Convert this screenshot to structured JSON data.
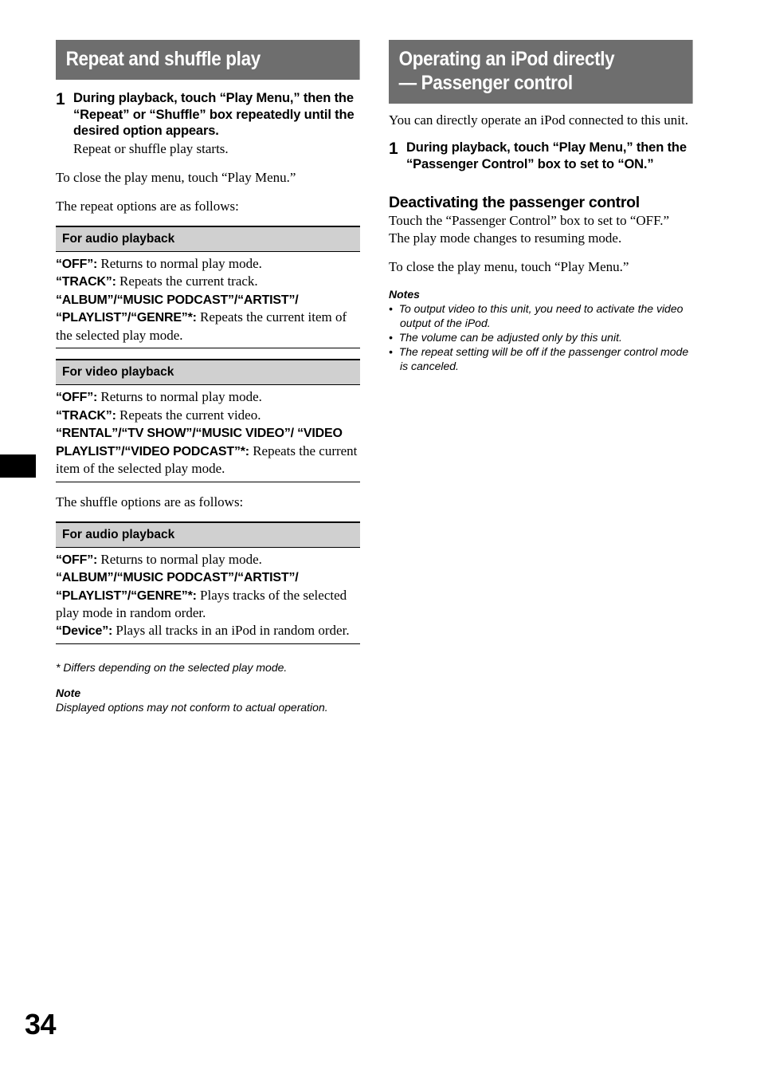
{
  "page": {
    "folio": "34",
    "edge_tab_color": "#000000",
    "header_bar_color": "#6e6e6e",
    "band_color": "#d0d0d0"
  },
  "left_column": {
    "header": {
      "lines": [
        "Repeat and shuffle play"
      ]
    },
    "step": {
      "number": "1",
      "title": "During playback, touch “Play Menu,” then the “Repeat” or “Shuffle” box repeatedly until the desired option appears.",
      "sub": "Repeat or shuffle play starts."
    },
    "close_note": "To close the play menu, touch “Play Menu.”",
    "repeat_intro": "The repeat options are as follows:",
    "repeat_audio": {
      "band": "For audio playback",
      "options": [
        {
          "term": "“OFF”:",
          "desc": " Returns to normal play mode."
        },
        {
          "term": "“TRACK”:",
          "desc": " Repeats the current track."
        },
        {
          "term": "“ALBUM”/“MUSIC PODCAST”/“ARTIST”/ “PLAYLIST”/“GENRE”*:",
          "desc": " Repeats the current item of the selected play mode."
        }
      ]
    },
    "repeat_video": {
      "band": "For video playback",
      "options": [
        {
          "term": "“OFF”:",
          "desc": " Returns to normal play mode."
        },
        {
          "term": "“TRACK”:",
          "desc": " Repeats the current video."
        },
        {
          "term": "“RENTAL”/“TV SHOW”/“MUSIC VIDEO”/ “VIDEO PLAYLIST”/“VIDEO PODCAST”*:",
          "desc": " Repeats the current item of the selected play mode."
        }
      ]
    },
    "shuffle_intro": "The shuffle options are as follows:",
    "shuffle_audio": {
      "band": "For audio playback",
      "options": [
        {
          "term": "“OFF”:",
          "desc": " Returns to normal play mode."
        },
        {
          "term": "“ALBUM”/“MUSIC PODCAST”/“ARTIST”/ “PLAYLIST”/“GENRE”*:",
          "desc": " Plays tracks of the selected play mode in random order."
        },
        {
          "term": "“Device”:",
          "desc": " Plays all tracks in an iPod in random order."
        }
      ]
    },
    "footnote": "* Differs depending on the selected play mode.",
    "note_head": "Note",
    "note_body": "Displayed options may not conform to actual operation."
  },
  "right_column": {
    "header": {
      "lines": [
        "Operating an iPod directly",
        "— Passenger control"
      ]
    },
    "intro": "You can directly operate an iPod connected to this unit.",
    "step": {
      "number": "1",
      "title": "During playback, touch “Play Menu,” then the “Passenger Control” box to set to “ON.”"
    },
    "subhead": "Deactivating the passenger control",
    "sub_para_1": "Touch the “Passenger Control” box to set to “OFF.”",
    "sub_para_2": "The play mode changes to resuming mode.",
    "close_note": "To close the play menu, touch “Play Menu.”",
    "notes_head": "Notes",
    "notes": [
      "To output video to this unit, you need to activate the video output of the iPod.",
      "The volume can be adjusted only by this unit.",
      "The repeat setting will be off if the passenger control mode is canceled."
    ]
  }
}
